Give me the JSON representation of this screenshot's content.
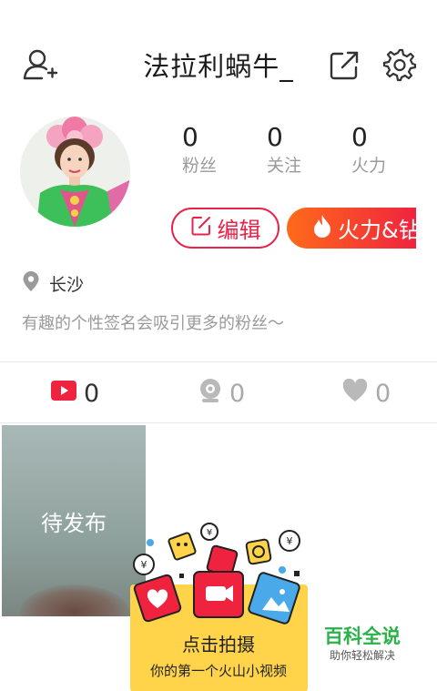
{
  "header": {
    "title": "法拉利蜗牛_"
  },
  "profile": {
    "stats": [
      {
        "value": "0",
        "label": "粉丝"
      },
      {
        "value": "0",
        "label": "关注"
      },
      {
        "value": "0",
        "label": "火力"
      }
    ],
    "edit_label": "编辑",
    "fire_label": "火力&钻",
    "location": "长沙",
    "signature": "有趣的个性签名会吸引更多的粉丝～"
  },
  "tabs": [
    {
      "icon": "video-icon",
      "count": "0"
    },
    {
      "icon": "camera-icon",
      "count": "0"
    },
    {
      "icon": "heart-icon",
      "count": "0"
    }
  ],
  "videos": [
    {
      "label": "待发布"
    }
  ],
  "promo": {
    "main": "点击拍摄",
    "sub": "你的第一个火山小视频"
  },
  "watermark": {
    "main": "百科全说",
    "sub": "助你轻松解决"
  },
  "colors": {
    "accent": "#e8234a",
    "fire_start": "#ff6a1a",
    "promo_bg": "#ffd44a",
    "watermark": "#2cb24a"
  }
}
